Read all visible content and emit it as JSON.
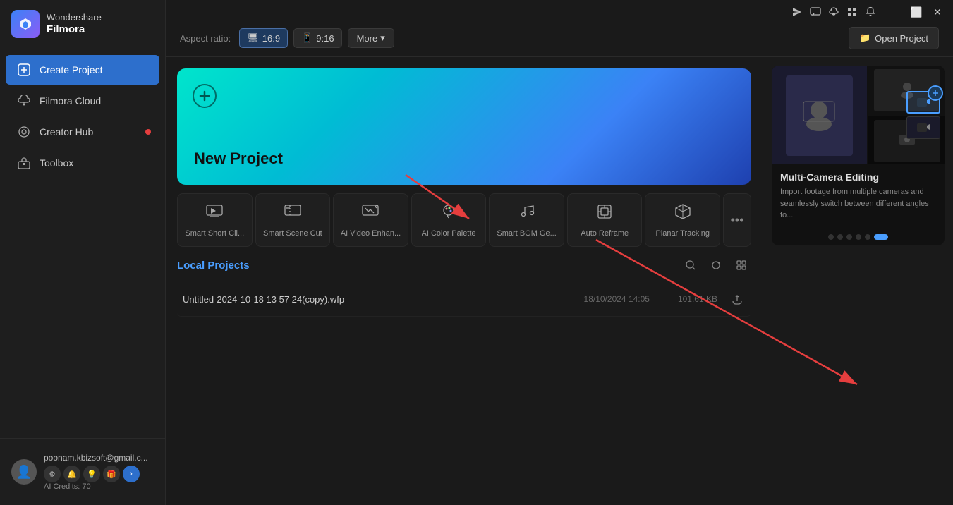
{
  "app": {
    "name1": "Wondershare",
    "name2": "Filmora"
  },
  "system_icons": [
    "send",
    "message",
    "cloud-upload",
    "grid",
    "bell"
  ],
  "window_controls": {
    "minimize": "—",
    "maximize": "⬜",
    "close": "✕"
  },
  "sidebar": {
    "items": [
      {
        "id": "create-project",
        "label": "Create Project",
        "icon": "➕",
        "active": true
      },
      {
        "id": "filmora-cloud",
        "label": "Filmora Cloud",
        "icon": "☁",
        "active": false
      },
      {
        "id": "creator-hub",
        "label": "Creator Hub",
        "icon": "◎",
        "active": false,
        "notification": true
      },
      {
        "id": "toolbox",
        "label": "Toolbox",
        "icon": "🧰",
        "active": false
      }
    ]
  },
  "user": {
    "email": "poonam.kbizsoft@gmail.c...",
    "ai_credits_label": "AI Credits: 70",
    "avatar_emoji": "👤"
  },
  "topbar": {
    "aspect_ratio_label": "Aspect ratio:",
    "aspect_16_9": "16:9",
    "aspect_9_16": "9:16",
    "more_label": "More",
    "open_project_label": "Open Project"
  },
  "new_project": {
    "label": "New Project"
  },
  "tools": [
    {
      "id": "smart-short-clip",
      "label": "Smart Short Cli...",
      "icon": "🎬"
    },
    {
      "id": "smart-scene-cut",
      "label": "Smart Scene Cut",
      "icon": "✂"
    },
    {
      "id": "ai-video-enhance",
      "label": "AI Video Enhan...",
      "icon": "✨"
    },
    {
      "id": "ai-color-palette",
      "label": "AI Color Palette",
      "icon": "🎨"
    },
    {
      "id": "smart-bgm-gen",
      "label": "Smart BGM Ge...",
      "icon": "🎵"
    },
    {
      "id": "auto-reframe",
      "label": "Auto Reframe",
      "icon": "📐"
    },
    {
      "id": "planar-tracking",
      "label": "Planar Tracking",
      "icon": "🔷"
    }
  ],
  "tools_more": "⋯",
  "local_projects": {
    "title": "Local Projects",
    "items": [
      {
        "name": "Untitled-2024-10-18 13 57 24(copy).wfp",
        "date": "18/10/2024 14:05",
        "size": "101.61 KB"
      }
    ]
  },
  "feature_card": {
    "title": "Multi-Camera Editing",
    "description": "Import footage from multiple cameras and seamlessly switch between different angles fo...",
    "dots": [
      0,
      1,
      2,
      3,
      4,
      5
    ],
    "active_dot": 5
  },
  "section_actions": {
    "search": "🔍",
    "refresh": "↻",
    "grid": "⊞"
  }
}
